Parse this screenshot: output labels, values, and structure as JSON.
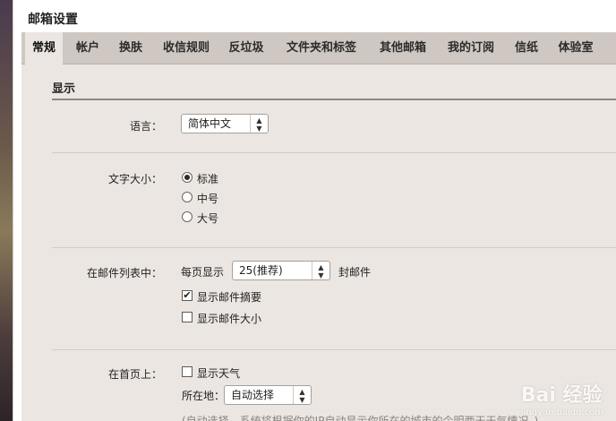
{
  "window": {
    "title": "邮箱设置"
  },
  "tabs": [
    {
      "label": "常规",
      "active": true
    },
    {
      "label": "帐户"
    },
    {
      "label": "换肤"
    },
    {
      "label": "收信规则"
    },
    {
      "label": "反垃圾"
    },
    {
      "label": "文件夹和标签"
    },
    {
      "label": "其他邮箱"
    },
    {
      "label": "我的订阅"
    },
    {
      "label": "信纸"
    },
    {
      "label": "体验室"
    }
  ],
  "display": {
    "section_title": "显示",
    "language": {
      "label": "语言：",
      "value": "简体中文"
    },
    "font_size": {
      "label": "文字大小：",
      "options": [
        {
          "label": "标准",
          "checked": true
        },
        {
          "label": "中号",
          "checked": false
        },
        {
          "label": "大号",
          "checked": false
        }
      ]
    },
    "mail_list": {
      "label": "在邮件列表中：",
      "per_page_prefix": "每页显示",
      "per_page_value": "25(推荐)",
      "per_page_suffix": "封邮件",
      "show_summary": {
        "label": "显示邮件摘要",
        "checked": true
      },
      "show_size": {
        "label": "显示邮件大小",
        "checked": false
      }
    },
    "homepage": {
      "label": "在首页上：",
      "show_weather": {
        "label": "显示天气",
        "checked": false
      },
      "location_label": "所在地：",
      "location_value": "自动选择",
      "hint": "(自动选择，系统将根据你的IP自动显示你所在的城市的今明两天天气情况。)"
    }
  },
  "watermark": {
    "main": "Bai 经验",
    "sub": "jingyan.baidu.com"
  },
  "colors": {
    "panel_bg": "#ebe6e1",
    "tabbar_bg": "#cfc8c2",
    "rule": "#8f8680"
  }
}
